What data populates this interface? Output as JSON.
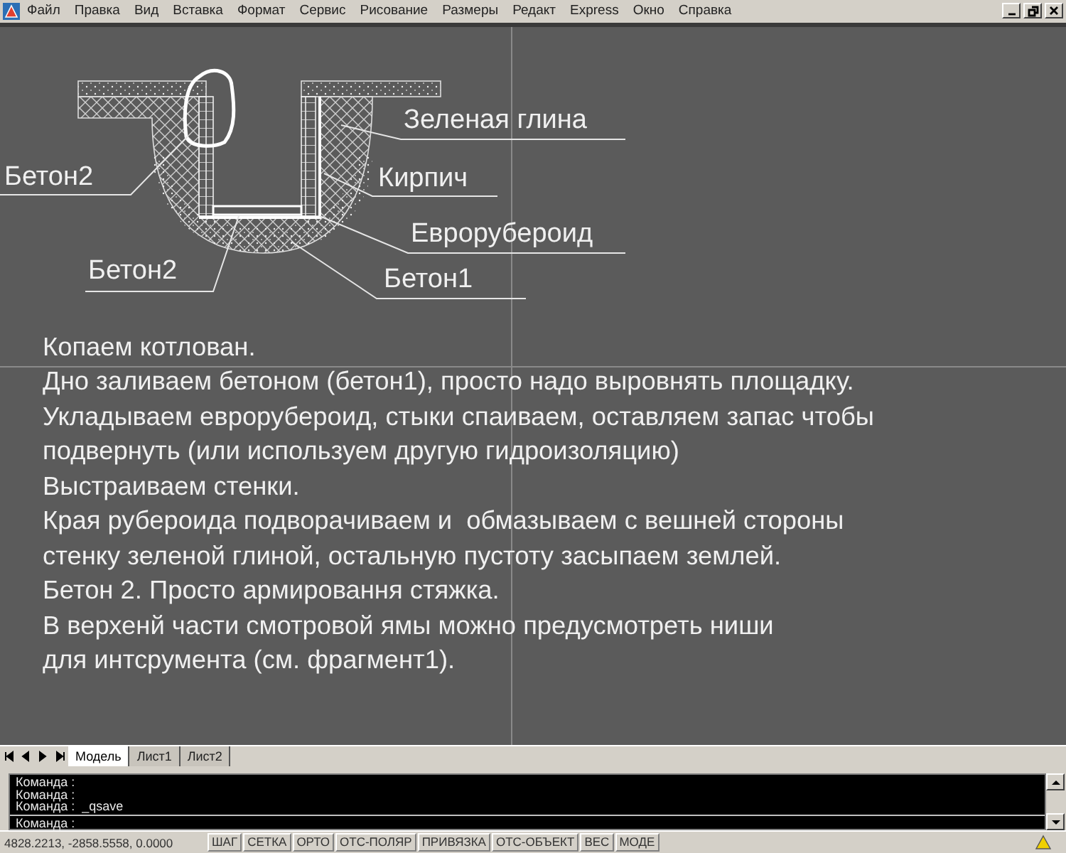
{
  "menu": {
    "items": [
      "Файл",
      "Правка",
      "Вид",
      "Вставка",
      "Формат",
      "Сервис",
      "Рисование",
      "Размеры",
      "Редакт",
      "Express",
      "Окно",
      "Справка"
    ]
  },
  "drawing": {
    "labels": [
      "Зеленая глина",
      "Кирпич",
      "Еврорубероид",
      "Бетон1",
      "Бетон2",
      "Бетон2"
    ]
  },
  "notes": {
    "lines": [
      "Копаем котлован.",
      "Дно заливаем бетоном (бетон1), просто надо выровнять площадку.",
      "Укладываем еврорубероид, стыки спаиваем, оставляем запас чтобы",
      "подвернуть (или используем другую гидроизоляцию)",
      "Выстраиваем стенки.",
      "Края рубероида подворачиваем и  обмазываем с вешней стороны",
      "стенку зеленой глиной, остальную пустоту засыпаем землей.",
      "Бетон 2. Просто армировання стяжка.",
      "В верхенй части смотровой ямы можно предусмотреть ниши",
      "для интсрумента (см. фрагмент1)."
    ]
  },
  "layout_tabs": [
    {
      "label": "Модель",
      "selected": true
    },
    {
      "label": "Лист1",
      "selected": false
    },
    {
      "label": "Лист2",
      "selected": false
    }
  ],
  "command_line": {
    "history": [
      "Команда :",
      "Команда :",
      "Команда :  _qsave"
    ],
    "prompt": "Команда :"
  },
  "status_bar": {
    "coordinates": "4828.2213, -2858.5558, 0.0000",
    "toggles": [
      "ШАГ",
      "СЕТКА",
      "ОРТО",
      "ОТС-ПОЛЯР",
      "ПРИВЯЗКА",
      "ОТС-ОБЪЕКТ",
      "ВЕС",
      "МОДЕ"
    ]
  }
}
